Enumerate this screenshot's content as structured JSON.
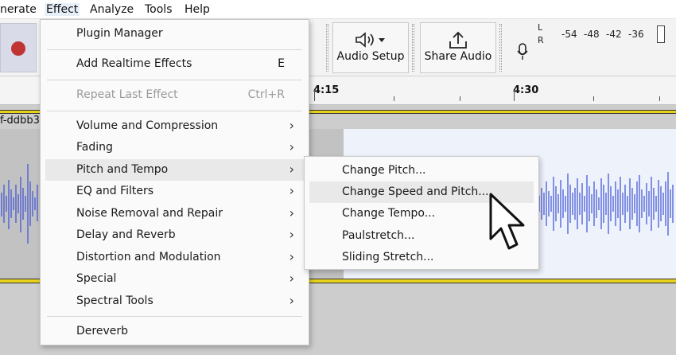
{
  "menubar": {
    "items": [
      "nerate",
      "Effect",
      "Analyze",
      "Tools",
      "Help"
    ]
  },
  "toolbar": {
    "audio_setup_label": "Audio Setup",
    "share_audio_label": "Share Audio",
    "meter_scale": [
      "L",
      "R",
      "-54",
      "-48",
      "-42",
      "-36"
    ]
  },
  "timeline": {
    "marks": [
      "4:15",
      "4:30"
    ]
  },
  "track": {
    "name": "f-ddbb3"
  },
  "effect_menu": {
    "plugin_manager": "Plugin Manager",
    "add_realtime": "Add Realtime Effects",
    "add_realtime_shortcut": "E",
    "repeat_last": "Repeat Last Effect",
    "repeat_last_shortcut": "Ctrl+R",
    "categories": [
      "Volume and Compression",
      "Fading",
      "Pitch and Tempo",
      "EQ and Filters",
      "Noise Removal and Repair",
      "Delay and Reverb",
      "Distortion and Modulation",
      "Special",
      "Spectral Tools"
    ],
    "dereverb": "Dereverb"
  },
  "submenu": {
    "items": [
      "Change Pitch...",
      "Change Speed and Pitch...",
      "Change Tempo...",
      "Paulstretch...",
      "Sliding Stretch..."
    ]
  },
  "colors": {
    "waveform": "#3b4fd6",
    "track_border": "#e8d21a",
    "record": "#c03434",
    "selection": "#eef2fb"
  },
  "icons": {
    "record": "record-icon",
    "speaker": "speaker-icon",
    "share": "share-icon",
    "mic": "microphone-icon",
    "cursor": "mouse-cursor-icon"
  }
}
